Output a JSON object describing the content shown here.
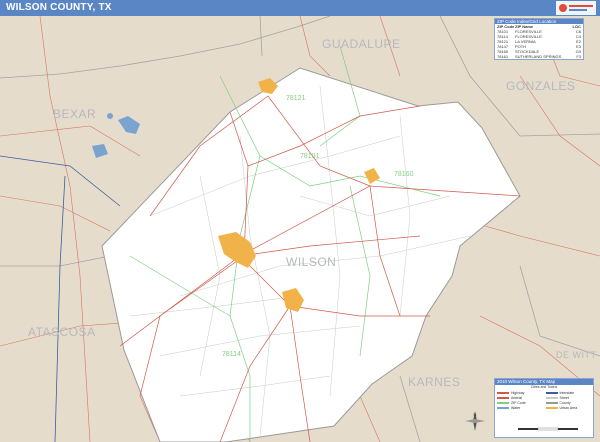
{
  "header": {
    "title": "WILSON COUNTY, TX",
    "brand_color": "#5b86c6"
  },
  "map": {
    "counties": {
      "guadalupe": "GUADALUPE",
      "gonzales": "GONZALES",
      "bexar": "BEXAR",
      "wilson": "WILSON",
      "atascosa": "ATASCOSA",
      "karnes": "KARNES",
      "dewitt": "DE WITT"
    },
    "zip_labels": [
      "78121",
      "78101",
      "78160",
      "78114"
    ],
    "colors": {
      "background_land": "#e6dccb",
      "county_fill": "#ffffff",
      "county_border": "#9a9a9a",
      "roads_major": "#d05a4a",
      "roads_minor": "#c8c8c8",
      "zip_boundary": "#7fcf7f",
      "urban": "#f2b24a",
      "water": "#7aa3cf"
    }
  },
  "zip_table": {
    "title": "ZIP Code Index/Grid Location",
    "columns": [
      "ZIP Code",
      "ZIP Name",
      "LOC"
    ],
    "rows": [
      [
        "78101",
        "FLORESVILLE",
        "C6"
      ],
      [
        "78114",
        "FLORESVILLE",
        "C4"
      ],
      [
        "78121",
        "LA VERNIA",
        "E2"
      ],
      [
        "78147",
        "POTH",
        "E3"
      ],
      [
        "78160",
        "STOCKDALE",
        "G3"
      ],
      [
        "78161",
        "SUTHERLAND SPRINGS",
        "F3"
      ]
    ]
  },
  "legend": {
    "title": "2010 Wilson County, TX Map",
    "subtitle": "Cities and Towns",
    "items": [
      {
        "label": "Highway",
        "color": "#d05a4a"
      },
      {
        "label": "Interstate",
        "color": "#3a5fa0"
      },
      {
        "label": "Arterial",
        "color": "#d05a4a"
      },
      {
        "label": "Street",
        "color": "#c8c8c8"
      },
      {
        "label": "ZIP Code",
        "color": "#7fcf7f"
      },
      {
        "label": "County",
        "color": "#9a9a9a"
      },
      {
        "label": "Water",
        "color": "#7aa3cf"
      },
      {
        "label": "Urban Area",
        "color": "#f2b24a"
      }
    ]
  }
}
